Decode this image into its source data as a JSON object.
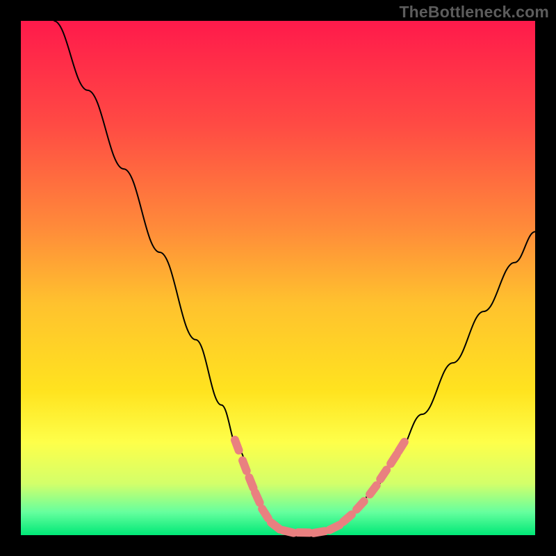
{
  "watermark": "TheBottleneck.com",
  "chart_data": {
    "type": "line",
    "title": "",
    "xlabel": "",
    "ylabel": "",
    "xlim": [
      0,
      100
    ],
    "ylim": [
      0,
      100
    ],
    "background_gradient": {
      "type": "vertical",
      "stops": [
        {
          "offset": 0.0,
          "color": "#ff1a4b"
        },
        {
          "offset": 0.2,
          "color": "#ff4a44"
        },
        {
          "offset": 0.4,
          "color": "#ff8a3a"
        },
        {
          "offset": 0.55,
          "color": "#ffc22e"
        },
        {
          "offset": 0.72,
          "color": "#ffe31f"
        },
        {
          "offset": 0.82,
          "color": "#feff4a"
        },
        {
          "offset": 0.9,
          "color": "#d3ff6a"
        },
        {
          "offset": 0.955,
          "color": "#66ff9e"
        },
        {
          "offset": 1.0,
          "color": "#00e877"
        }
      ]
    },
    "series": [
      {
        "name": "bottleneck-curve",
        "color": "#000000",
        "points": [
          {
            "x": 6.4,
            "y": 100.0
          },
          {
            "x": 13.0,
            "y": 86.5
          },
          {
            "x": 20.0,
            "y": 71.2
          },
          {
            "x": 27.0,
            "y": 55.0
          },
          {
            "x": 34.0,
            "y": 38.0
          },
          {
            "x": 39.0,
            "y": 25.3
          },
          {
            "x": 42.4,
            "y": 16.5
          },
          {
            "x": 45.5,
            "y": 8.5
          },
          {
            "x": 48.0,
            "y": 3.5
          },
          {
            "x": 50.5,
            "y": 1.2
          },
          {
            "x": 53.0,
            "y": 0.5
          },
          {
            "x": 56.0,
            "y": 0.5
          },
          {
            "x": 59.0,
            "y": 0.8
          },
          {
            "x": 62.0,
            "y": 2.0
          },
          {
            "x": 65.0,
            "y": 4.5
          },
          {
            "x": 69.0,
            "y": 9.5
          },
          {
            "x": 73.0,
            "y": 15.5
          },
          {
            "x": 78.0,
            "y": 23.5
          },
          {
            "x": 84.0,
            "y": 33.5
          },
          {
            "x": 90.0,
            "y": 43.5
          },
          {
            "x": 96.0,
            "y": 53.0
          },
          {
            "x": 100.0,
            "y": 59.0
          }
        ]
      },
      {
        "name": "highlight-segments",
        "color": "#e98080",
        "style": "thick-dash",
        "points": [
          {
            "x": 42.0,
            "y": 17.5
          },
          {
            "x": 43.5,
            "y": 13.5
          },
          {
            "x": 44.8,
            "y": 10.2
          },
          {
            "x": 46.0,
            "y": 7.3
          },
          {
            "x": 47.5,
            "y": 4.2
          },
          {
            "x": 49.5,
            "y": 1.8
          },
          {
            "x": 52.0,
            "y": 0.7
          },
          {
            "x": 55.0,
            "y": 0.5
          },
          {
            "x": 58.0,
            "y": 0.6
          },
          {
            "x": 61.0,
            "y": 1.5
          },
          {
            "x": 63.5,
            "y": 3.3
          },
          {
            "x": 66.0,
            "y": 5.8
          },
          {
            "x": 68.5,
            "y": 8.8
          },
          {
            "x": 70.5,
            "y": 11.8
          },
          {
            "x": 72.5,
            "y": 14.8
          },
          {
            "x": 74.0,
            "y": 17.2
          }
        ]
      }
    ]
  }
}
